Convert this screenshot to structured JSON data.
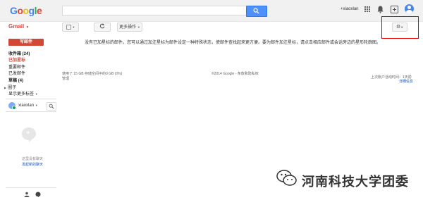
{
  "logo": {
    "letters": [
      "G",
      "o",
      "o",
      "g",
      "l",
      "e"
    ],
    "colors": [
      "#4285f4",
      "#ea4335",
      "#fbbc05",
      "#4285f4",
      "#34a853",
      "#ea4335"
    ]
  },
  "header": {
    "user_label": "+xiaoxlan"
  },
  "app_label": "Gmail",
  "toolbar": {
    "more_label": "更多操作"
  },
  "sidebar": {
    "compose_label": "写邮件",
    "items": [
      {
        "label": "收件箱 (24)"
      },
      {
        "label": "已加星标"
      },
      {
        "label": "重要邮件"
      },
      {
        "label": "已发邮件"
      },
      {
        "label": "草稿 (4)"
      },
      {
        "label": "圈子"
      },
      {
        "label": "显示更多标签"
      }
    ]
  },
  "chat": {
    "user_name": "xiaoxlan",
    "empty_text": "这里没有聊天",
    "start_link": "发起新的聊天"
  },
  "main": {
    "empty_message": "没有已加星标的邮件。您可以通过加注星标为邮件设定一种特殊状态，使邮件查找起来更方便。要为邮件加注星标，请点击相应邮件或会话旁边的星形轮廓图。",
    "usage": "使用了 15 GB 存储空间中的0 GB (0%)",
    "manage": "管理",
    "copyright": "©2014 Google - 条款和隐私权",
    "last_activity": "上次账户活动时间：1天前",
    "details_link": "详细信息"
  },
  "watermark": "河南科技大学团委",
  "colors": {
    "accent": "#dd4b39",
    "search_blue": "#4d90fe",
    "highlight": "#e00000"
  }
}
